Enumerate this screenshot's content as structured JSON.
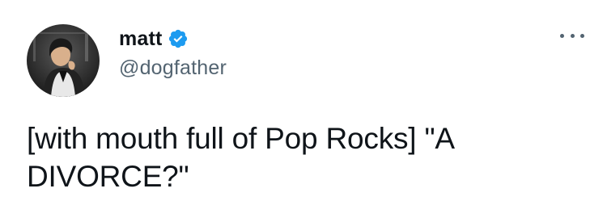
{
  "author": {
    "display_name": "matt",
    "handle": "@dogfather",
    "verified": true,
    "verified_icon": "verified-badge-icon",
    "verified_color": "#1d9bf0"
  },
  "menu": {
    "icon": "more-options-icon"
  },
  "tweet": {
    "text": "[with mouth full of Pop Rocks] \"A DIVORCE?\""
  },
  "colors": {
    "text_primary": "#0f1419",
    "text_secondary": "#536471",
    "background": "#ffffff"
  }
}
